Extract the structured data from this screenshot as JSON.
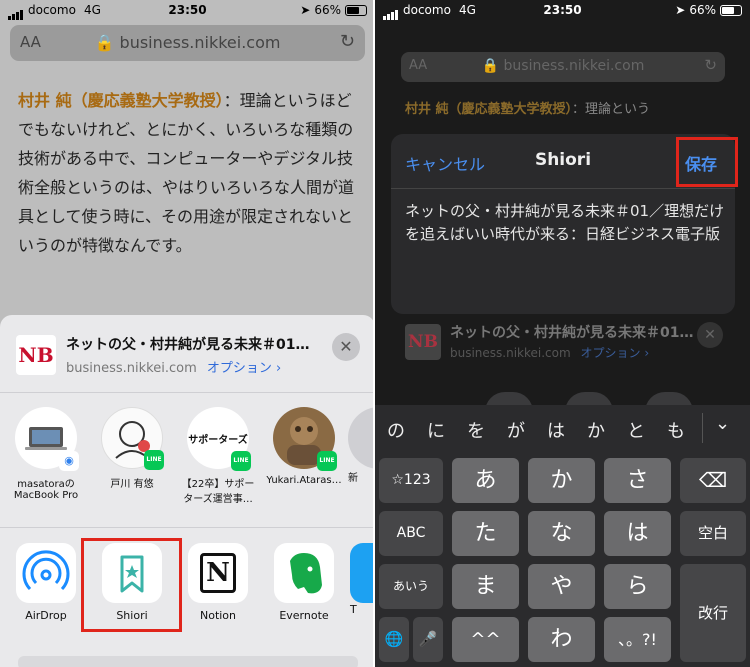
{
  "left": {
    "status": {
      "carrier": "docomo",
      "network": "4G",
      "time": "23:50",
      "battery": "66%"
    },
    "url_bar": {
      "aa": "AA",
      "domain": "business.nikkei.com"
    },
    "article": {
      "author": "村井 純（慶応義塾大学教授）",
      "text": "：理論というほどでもないけれど、とにかく、いろいろな種類の技術がある中で、コンピューターやデジタル技術全般というのは、やはりいろいろな人間が道具として使う時に、その用途が限定されないというのが特徴なんです。"
    },
    "share_sheet": {
      "logo": "NB",
      "title": "ネットの父・村井純が見る未来＃01…",
      "domain": "business.nikkei.com",
      "options": "オプション ›",
      "close": "✕",
      "contacts": [
        {
          "label1": "masatoraの",
          "label2": "MacBook Pro"
        },
        {
          "label1": "戸川 有悠",
          "label2": ""
        },
        {
          "label1": "【22卒】サポー",
          "label2": "ターズ運営事…"
        },
        {
          "label1": "Yukari.Ataras…",
          "label2": ""
        },
        {
          "label1": "新",
          "label2": ""
        }
      ],
      "contact_badge_line": "LINE",
      "supporters_avatar_text": "サポーターズ",
      "apps": [
        {
          "label": "AirDrop"
        },
        {
          "label": "Shiori"
        },
        {
          "label": "Notion"
        },
        {
          "label": "Evernote"
        },
        {
          "label": "T"
        }
      ],
      "notion_glyph": "N"
    }
  },
  "right": {
    "status": {
      "carrier": "docomo",
      "network": "4G",
      "time": "23:50",
      "battery": "66%"
    },
    "url_bar": {
      "aa": "AA",
      "domain": "business.nikkei.com"
    },
    "article": {
      "author": "村井 純（慶応義塾大学教授）",
      "text": "：理論という"
    },
    "dialog": {
      "cancel": "キャンセル",
      "title": "Shiori",
      "save": "保存",
      "body": "ネットの父・村井純が見る未来＃01／理想だけを追えばいい時代が来る：日経ビジネス電子版"
    },
    "share_sheet": {
      "logo": "NB",
      "title": "ネットの父・村井純が見る未来＃01…",
      "domain": "business.nikkei.com",
      "options": "オプション ›",
      "close": "✕"
    },
    "keyboard": {
      "predictions": [
        "の",
        "に",
        "を",
        "が",
        "は",
        "か",
        "と",
        "も"
      ],
      "collapse": "⌄",
      "row1": [
        "☆123",
        "あ",
        "か",
        "さ",
        "⌫"
      ],
      "row2": [
        "ABC",
        "た",
        "な",
        "は",
        "空白"
      ],
      "row3": [
        "あいう",
        "ま",
        "や",
        "ら",
        "改行"
      ],
      "row4": [
        "🌐",
        "🎤",
        "^^",
        "わ",
        "、。?!"
      ]
    }
  }
}
